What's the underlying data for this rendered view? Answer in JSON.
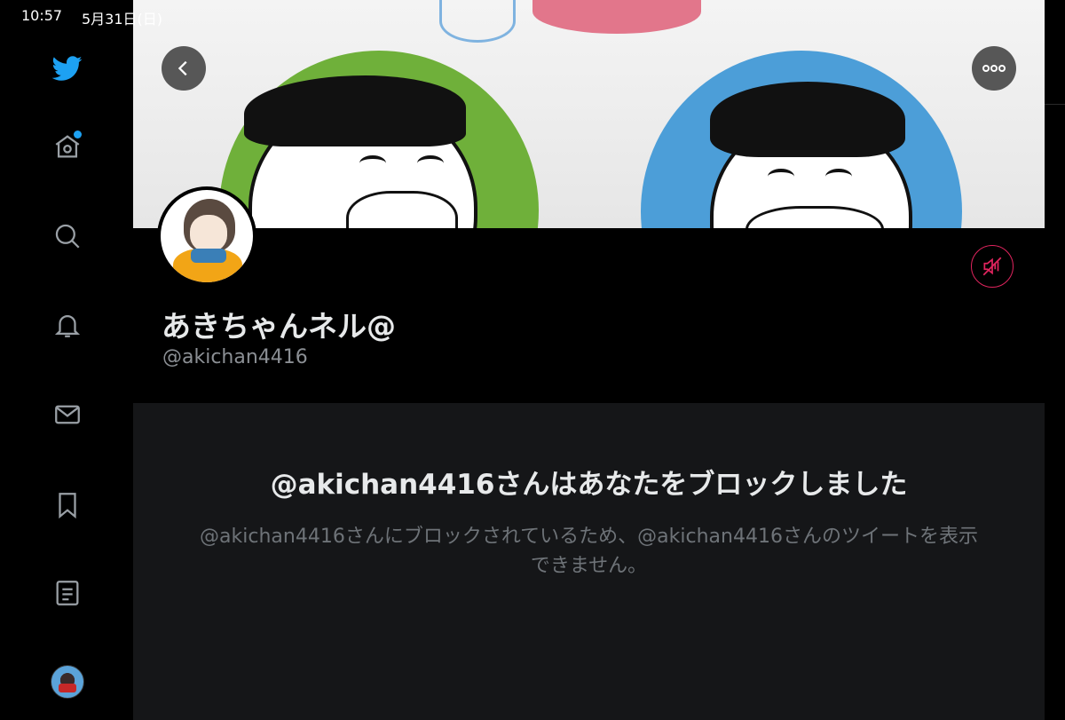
{
  "status_bar": {
    "time": "10:57",
    "date": "5月31日(日)"
  },
  "sidebar": {
    "items": [
      {
        "name": "twitter-logo",
        "icon": "bird-icon"
      },
      {
        "name": "home",
        "icon": "home-icon",
        "has_notification_dot": true
      },
      {
        "name": "explore",
        "icon": "search-icon"
      },
      {
        "name": "notifications",
        "icon": "bell-icon"
      },
      {
        "name": "messages",
        "icon": "envelope-icon"
      },
      {
        "name": "bookmarks",
        "icon": "bookmark-icon"
      },
      {
        "name": "lists",
        "icon": "list-icon"
      },
      {
        "name": "account",
        "icon": "avatar"
      }
    ]
  },
  "profile": {
    "display_name": "あきちゃんネル@",
    "handle": "@akichan4416",
    "muted": true
  },
  "blocked_notice": {
    "title": "@akichan4416さんはあなたをブロックしました",
    "description": "@akichan4416さんにブロックされているため、@akichan4416さんのツイートを表示できません。"
  },
  "colors": {
    "accent": "#1da1f2",
    "mute_red": "#e0245e",
    "panel_bg": "#151618",
    "secondary_text": "#6e7378"
  }
}
